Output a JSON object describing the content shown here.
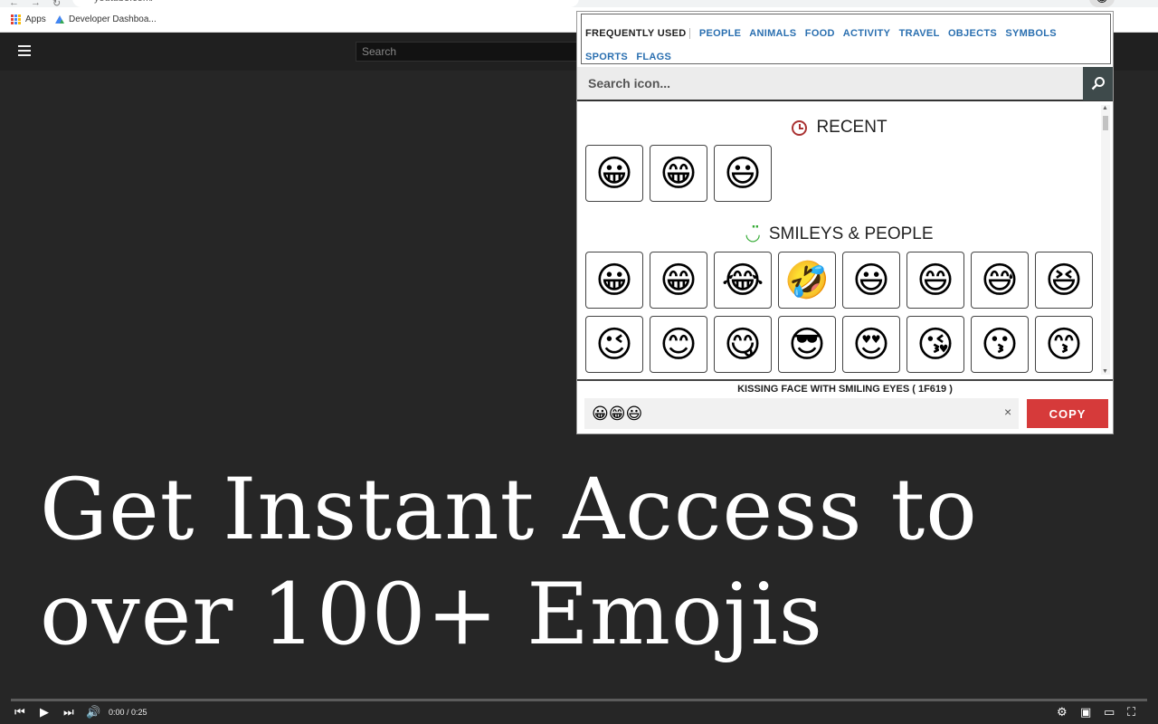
{
  "browser": {
    "url": "youtube.com/",
    "bookmarks": [
      {
        "label": "Apps"
      },
      {
        "label": "Developer Dashboa..."
      }
    ],
    "extension_emoji": "😀"
  },
  "youtube": {
    "search_placeholder": "Search",
    "overlay_line1": "Get Instant Access to",
    "overlay_line2": "over 100+ Emojis",
    "time": "0:00 / 0:25"
  },
  "popup": {
    "categories": [
      "FREQUENTLY USED",
      "PEOPLE",
      "ANIMALS",
      "FOOD",
      "ACTIVITY",
      "TRAVEL",
      "OBJECTS",
      "SYMBOLS",
      "SPORTS",
      "FLAGS"
    ],
    "search_placeholder": "Search icon...",
    "recent_title": "RECENT",
    "recent": [
      "😀",
      "😁",
      "😃"
    ],
    "smileys_title": "SMILEYS & PEOPLE",
    "smileys_row1": [
      "😀",
      "😁",
      "😂",
      "🤣",
      "😃",
      "😄",
      "😅",
      "😆"
    ],
    "smileys_row2": [
      "😉",
      "😊",
      "😋",
      "😎",
      "😍",
      "😘",
      "😗",
      "😙"
    ],
    "selected_name": "KISSING FACE WITH SMILING EYES ( 1F619 )",
    "output": "😀😁😃",
    "clear_label": "×",
    "copy_label": "COPY"
  },
  "colors": {
    "copy_button": "#d63a3a",
    "category_link": "#2a6fb0",
    "video_bg": "#262626"
  }
}
